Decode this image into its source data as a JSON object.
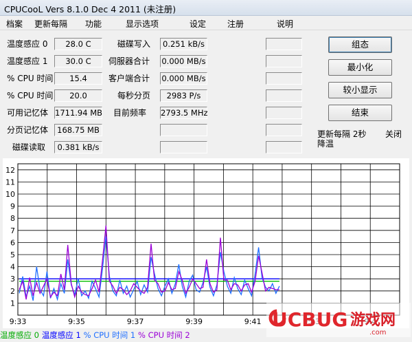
{
  "window": {
    "title": "CPUCooL  Vers 8.1.0  Dec  4 2011 (未注册)"
  },
  "menu": [
    "档案",
    "更新每隔",
    "功能",
    "显示选项",
    "设定",
    "注册",
    "说明"
  ],
  "sensors_left": [
    {
      "label": "温度感应 0",
      "value": "28.0 C"
    },
    {
      "label": "温度感应 1",
      "value": "30.0 C"
    },
    {
      "label": "% CPU 时间",
      "value": "15.4"
    },
    {
      "label": "% CPU 时间",
      "value": "20.0"
    },
    {
      "label": "可用记忆体",
      "value": "1711.94 MB"
    },
    {
      "label": "分页记忆体",
      "value": "168.75 MB"
    },
    {
      "label": "磁碟读取",
      "value": "0.381 kB/s"
    }
  ],
  "sensors_mid": [
    {
      "label": "磁碟写入",
      "value": "0.251 kB/s"
    },
    {
      "label": "伺服器合计",
      "value": "0.000 MB/s"
    },
    {
      "label": "客户端合计",
      "value": "0.000 MB/s"
    },
    {
      "label": "每秒分页",
      "value": "2983 P/s"
    },
    {
      "label": "目前频率",
      "value": "2793.5 MHz"
    },
    {
      "label": "",
      "value": ""
    },
    {
      "label": "",
      "value": ""
    }
  ],
  "buttons": [
    "组态",
    "最小化",
    "较小显示",
    "结束"
  ],
  "status": {
    "update": "更新每隔 2秒",
    "close": "关闭",
    "cool": "降温"
  },
  "chart_data": {
    "type": "line",
    "title": "",
    "x_ticks": [
      "9:33",
      "9:35",
      "9:37",
      "9:39",
      "9:41",
      "9:43",
      "9:4"
    ],
    "y_ticks": [
      1,
      2,
      3,
      4,
      5,
      6,
      7,
      8,
      9,
      10,
      11,
      12
    ],
    "ylim": [
      0,
      12.5
    ],
    "grid": true,
    "series": [
      {
        "name": "温度感应 0",
        "color": "#00bb00",
        "values": [
          2.8,
          2.8,
          2.8,
          2.8,
          2.8,
          2.8,
          2.8,
          2.8,
          2.8,
          2.8,
          2.8,
          2.8,
          2.8,
          2.8,
          2.8,
          2.8,
          2.8,
          2.8,
          2.8,
          2.8
        ]
      },
      {
        "name": "温度感应 1",
        "color": "#0000ff",
        "values": [
          3.0,
          3.0,
          3.0,
          3.0,
          3.0,
          3.0,
          3.0,
          3.0,
          3.0,
          3.0,
          3.0,
          3.0,
          3.0,
          3.0,
          3.0,
          3.0,
          3.0,
          3.0,
          3.0,
          3.0
        ]
      },
      {
        "name": "% CPU 时间 1",
        "color": "#1e6eff",
        "values": [
          1.8,
          3.2,
          1.5,
          2.4,
          1.2,
          4.0,
          2.1,
          1.6,
          3.6,
          1.4,
          2.2,
          1.3,
          2.6,
          1.8,
          4.6,
          2.5,
          1.7,
          3.0,
          1.6,
          2.0,
          1.4,
          2.8,
          2.2,
          1.5,
          3.8,
          6.5,
          3.2,
          2.0,
          1.6,
          2.9,
          1.8,
          2.4,
          1.5,
          2.1,
          2.8,
          1.7,
          2.5,
          1.9,
          4.8,
          3.4,
          2.2,
          1.6,
          2.4,
          3.0,
          1.8,
          2.6,
          4.2,
          2.4,
          1.5,
          2.8,
          3.3,
          2.1,
          1.9,
          2.7,
          4.0,
          2.3,
          1.6,
          2.5,
          5.2,
          3.6,
          2.4,
          1.8,
          3.1,
          2.2,
          1.7,
          2.9,
          2.2,
          1.6,
          3.4,
          5.6,
          3.1,
          2.3,
          2.0,
          2.6,
          1.8,
          2.4
        ]
      },
      {
        "name": "% CPU 时间 2",
        "color": "#9a00d6",
        "values": [
          2.1,
          2.8,
          1.3,
          3.1,
          1.6,
          2.7,
          1.8,
          2.4,
          3.0,
          1.5,
          1.9,
          1.6,
          3.4,
          2.1,
          5.8,
          2.6,
          1.5,
          2.4,
          1.9,
          1.7,
          1.6,
          2.2,
          2.9,
          1.9,
          4.5,
          7.4,
          2.8,
          2.4,
          1.8,
          2.3,
          2.1,
          1.7,
          2.0,
          2.6,
          2.3,
          2.0,
          1.8,
          2.3,
          5.9,
          2.9,
          2.6,
          1.9,
          2.0,
          2.7,
          2.1,
          2.2,
          3.6,
          2.9,
          1.8,
          2.3,
          3.0,
          2.6,
          2.2,
          2.3,
          4.6,
          2.6,
          1.9,
          2.1,
          6.4,
          2.9,
          2.9,
          2.1,
          2.6,
          2.5,
          2.0,
          2.5,
          2.6,
          1.9,
          2.8,
          4.9,
          3.5,
          2.0,
          2.3,
          2.2,
          2.1,
          2.1
        ]
      }
    ],
    "legend": [
      {
        "label": "温度感应 0",
        "color": "#00aa00"
      },
      {
        "label": "温度感应 1",
        "color": "#0000ff"
      },
      {
        "label": "% CPU 时间 1",
        "color": "#1e6eff"
      },
      {
        "label": "% CPU 时间 2",
        "color": "#9a00d6"
      }
    ]
  },
  "watermark": {
    "brand": "UCBUG",
    "text": "游戏网",
    "url": ".com"
  }
}
